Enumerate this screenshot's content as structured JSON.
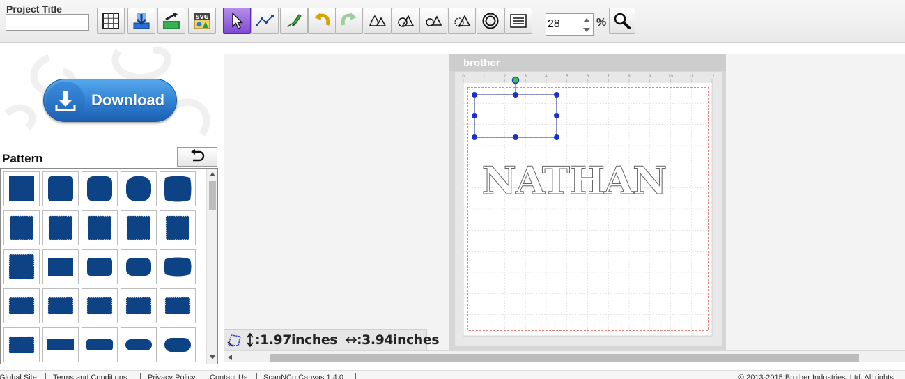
{
  "toolbar": {
    "project_title_label": "Project Title",
    "project_title_value": "",
    "zoom_value": "28",
    "zoom_unit": "%"
  },
  "left_panel": {
    "download_label": "Download",
    "pattern_label": "Pattern"
  },
  "canvas": {
    "brand": "brother",
    "text_object": "NATHAN",
    "ruler_numbers": [
      "0",
      "1",
      "2",
      "3",
      "4",
      "5",
      "6",
      "7",
      "8",
      "9",
      "10",
      "11",
      "12"
    ],
    "ruler_unit": "inch",
    "height_readout": "1.97inches",
    "width_readout": "3.94inches"
  },
  "footer": {
    "links": [
      "Global Site",
      "Terms and Conditions",
      "Privacy Policy",
      "Contact Us",
      "ScanNCutCanvas 1.4.0"
    ],
    "copyright": "© 2013-2015 Brother Industries, Ltd. All rights"
  },
  "colors": {
    "shape_fill": "#0d4285",
    "selection_handle": "#1a2fd0",
    "rotate_handle": "#33cc33",
    "cut_boundary": "#e53030",
    "select_tool_active": "#8a55dd"
  },
  "icons": [
    "grid-icon",
    "import-icon",
    "export-icon",
    "svg-icon",
    "select-arrow-icon",
    "point-edit-icon",
    "pen-icon",
    "undo-icon",
    "redo-icon",
    "shape-group-icon",
    "shape-combine-icon",
    "shape-subtract-icon",
    "shape-intersect-icon",
    "outline-icon",
    "text-list-icon",
    "zoom-icon"
  ]
}
